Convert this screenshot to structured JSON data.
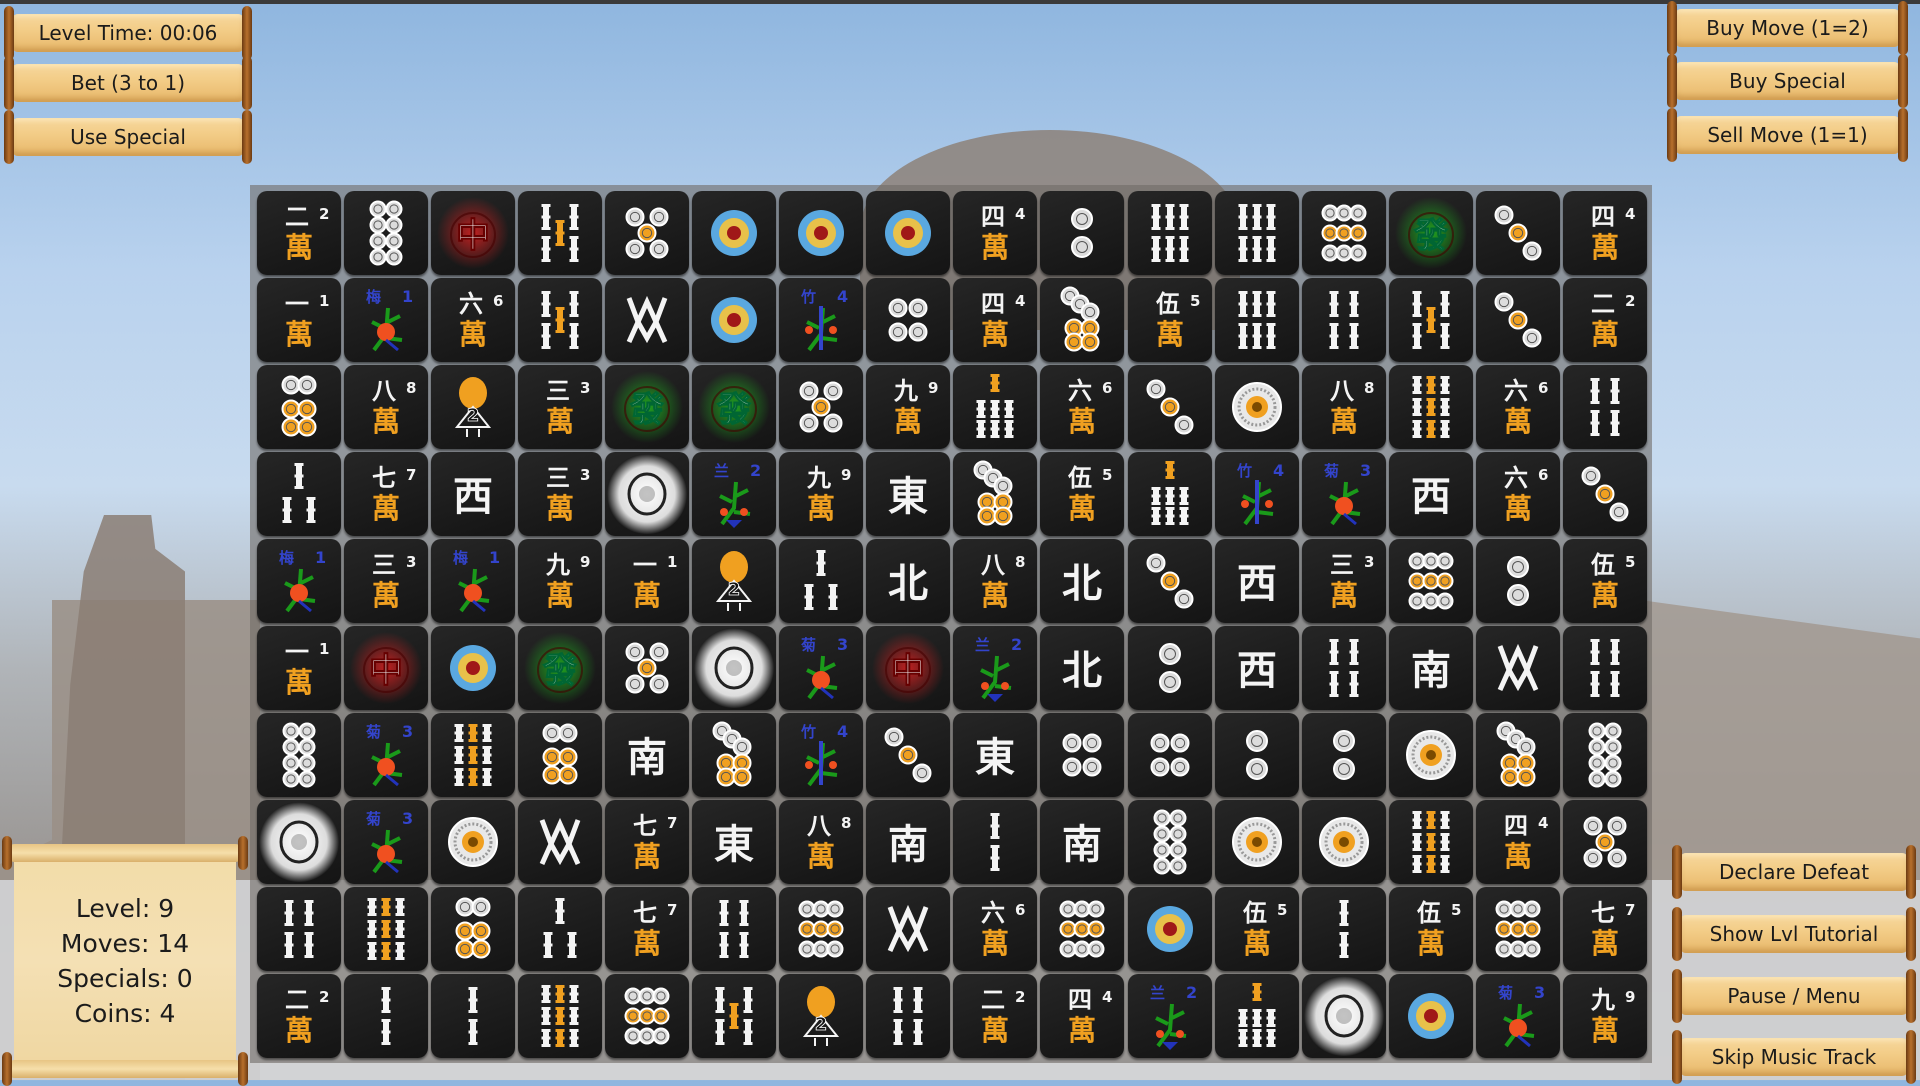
{
  "hud": {
    "level_time": "Level Time: 00:06",
    "bet": "Bet (3 to 1)",
    "use_special": "Use Special",
    "buy_move": "Buy Move (1=2)",
    "buy_special": "Buy Special",
    "sell_move": "Sell Move (1=1)",
    "declare_defeat": "Declare Defeat",
    "show_tutorial": "Show Lvl Tutorial",
    "pause_menu": "Pause / Menu",
    "skip_music": "Skip Music Track"
  },
  "stats": {
    "level": "Level: 9",
    "moves": "Moves: 14",
    "specials": "Specials: 0",
    "coins": "Coins: 4"
  },
  "colors": {
    "tile_bg": "#1e1e1e",
    "char_orange": "#f0a020",
    "circle_blue": "#5aa8e0",
    "circle_yellow": "#e8c14a",
    "circle_red": "#a01818",
    "red_dragon": "#d02020",
    "green_dragon": "#20b020",
    "flower_blue": "#3344cc",
    "scroll_paper": "#f3cd88"
  },
  "board": {
    "columns": 16,
    "rows": [
      [
        "char-2",
        "circle-8",
        "dragon-red",
        "bamboo-5",
        "circle-5",
        "circle-1",
        "circle-1",
        "circle-1",
        "char-4",
        "circle-2",
        "bamboo-6",
        "bamboo-6",
        "circle-9",
        "dragon-green",
        "circle-3",
        "char-4"
      ],
      [
        "char-1",
        "flower-plum-1",
        "char-6",
        "bamboo-5",
        "bamboo-8",
        "circle-1",
        "flower-bamboo-4",
        "circle-4",
        "char-4",
        "circle-7",
        "char-5",
        "bamboo-6",
        "bamboo-4",
        "bamboo-5",
        "circle-3",
        "char-2"
      ],
      [
        "circle-6",
        "char-8",
        "season-2",
        "char-3",
        "dragon-green",
        "dragon-green",
        "circle-5",
        "char-9",
        "bamboo-7",
        "char-6",
        "circle-3",
        "flower-disc",
        "char-8",
        "bamboo-9",
        "char-6",
        "bamboo-4"
      ],
      [
        "bamboo-3",
        "char-7",
        "wind-west",
        "char-3",
        "dragon-white",
        "flower-orchid-2",
        "char-9",
        "wind-east",
        "circle-7",
        "char-5",
        "bamboo-7",
        "flower-bamboo-4",
        "flower-chrysanthemum-3",
        "wind-west",
        "char-6",
        "circle-3"
      ],
      [
        "flower-plum-1",
        "char-3",
        "flower-plum-1",
        "char-9",
        "char-1",
        "season-2",
        "bamboo-3",
        "wind-north",
        "char-8",
        "wind-north",
        "circle-3",
        "wind-west",
        "char-3",
        "circle-9",
        "circle-2",
        "char-5"
      ],
      [
        "char-1",
        "dragon-red",
        "circle-1",
        "dragon-green",
        "circle-5",
        "dragon-white",
        "flower-chrysanthemum-3",
        "dragon-red",
        "flower-orchid-2",
        "wind-north",
        "circle-2",
        "wind-west",
        "bamboo-4",
        "wind-south",
        "bamboo-8",
        "bamboo-4"
      ],
      [
        "circle-8",
        "flower-chrysanthemum-3",
        "bamboo-9",
        "circle-6",
        "wind-south",
        "circle-7",
        "flower-bamboo-4",
        "circle-3",
        "wind-east",
        "circle-4",
        "circle-4",
        "circle-2",
        "circle-2",
        "flower-disc",
        "circle-7",
        "circle-8"
      ],
      [
        "dragon-white",
        "flower-chrysanthemum-3",
        "flower-disc",
        "bamboo-8",
        "char-7",
        "wind-east",
        "char-8",
        "wind-south",
        "bamboo-2",
        "wind-south",
        "circle-8",
        "flower-disc",
        "flower-disc",
        "bamboo-9",
        "char-4",
        "circle-5"
      ],
      [
        "bamboo-4",
        "bamboo-9",
        "circle-6",
        "bamboo-3",
        "char-7",
        "bamboo-4",
        "circle-9",
        "bamboo-8",
        "char-6",
        "circle-9",
        "circle-1",
        "char-5",
        "bamboo-2",
        "char-5",
        "circle-9",
        "char-7"
      ],
      [
        "char-2",
        "bamboo-2",
        "bamboo-2",
        "bamboo-9",
        "circle-9",
        "bamboo-5",
        "season-2",
        "bamboo-4",
        "char-2",
        "char-4",
        "flower-orchid-2",
        "bamboo-7",
        "dragon-white",
        "circle-1",
        "flower-chrysanthemum-3",
        "char-9"
      ]
    ]
  },
  "glyphs": {
    "char_numerals": [
      "一",
      "二",
      "三",
      "四",
      "伍",
      "六",
      "七",
      "八",
      "九"
    ],
    "wan": "萬",
    "winds": {
      "east": "東",
      "south": "南",
      "west": "西",
      "north": "北"
    },
    "dragons": {
      "red": "中",
      "green": "發"
    },
    "flowers": {
      "plum": "梅",
      "orchid": "兰",
      "bamboo": "竹",
      "chrysanthemum": "菊"
    }
  }
}
